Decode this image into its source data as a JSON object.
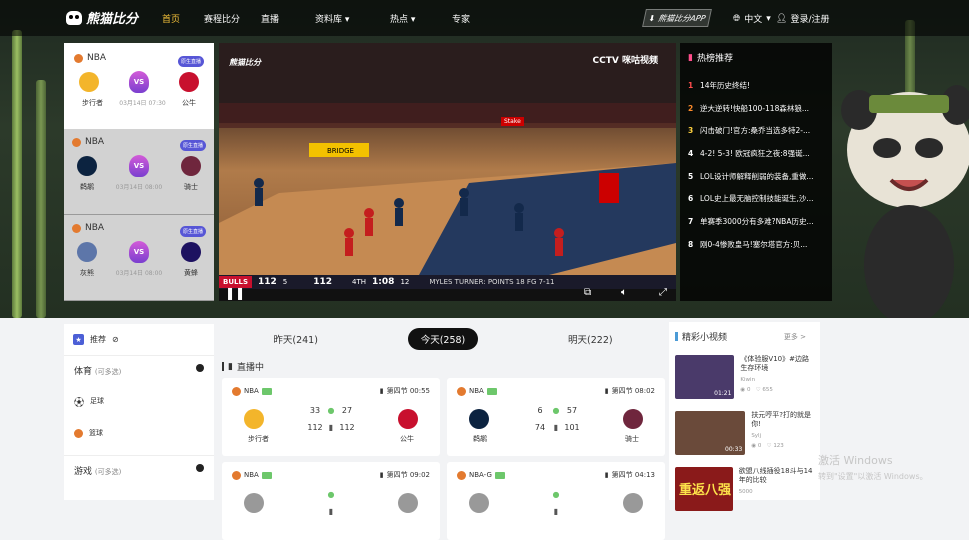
{
  "header": {
    "logo_text": "熊猫比分",
    "nav": [
      "首页",
      "赛程比分",
      "直播",
      "资料库 ▾",
      "热点 ▾",
      "专家"
    ],
    "app_button": "熊猫比分APP",
    "language": "中文",
    "login": "登录/注册"
  },
  "match_list": [
    {
      "league": "NBA",
      "badge": "原生直播",
      "home": "步行者",
      "away": "公牛",
      "time": "03月14日 07:30",
      "home_color": "#f3b52b",
      "away_color": "#c8102e"
    },
    {
      "league": "NBA",
      "badge": "原生直播",
      "home": "鹈鹕",
      "away": "骑士",
      "time": "03月14日 08:00",
      "home_color": "#0c2340",
      "away_color": "#6f263d"
    },
    {
      "league": "NBA",
      "badge": "原生直播",
      "home": "灰熊",
      "away": "黄蜂",
      "time": "03月14日 08:00",
      "home_color": "#5d76a9",
      "away_color": "#1d1160"
    }
  ],
  "vs_label": "VS",
  "player": {
    "logo_text": "熊猫比分",
    "channel": "CCTV 咪咕视频",
    "score_home_abbr": "BULLS",
    "score_home": "112",
    "score_home_fouls": "5",
    "score_away": "112",
    "quarter": "4TH",
    "clock": "1:08",
    "shot_clock": "12",
    "lower_text": "MYLES TURNER: POINTS 18 FG 7-11",
    "court_ad": "Stake"
  },
  "hot": {
    "title": "热榜推荐",
    "items": [
      {
        "num": "1",
        "text": "14年历史终结!",
        "color": "#ff4d4d"
      },
      {
        "num": "2",
        "text": "逆大逆转!快船100-118森林狼...",
        "color": "#ff8c2b"
      },
      {
        "num": "3",
        "text": "闪击破门!官方:桑乔当选多特2-...",
        "color": "#ffd23f"
      },
      {
        "num": "4",
        "text": "4-2! 5-3! 欧冠疯狂之夜:8强诞...",
        "color": "#fff"
      },
      {
        "num": "5",
        "text": "LOL设计师解释削弱的装备,重做...",
        "color": "#fff"
      },
      {
        "num": "6",
        "text": "LOL史上最无脑控制技能诞生,沙...",
        "color": "#fff"
      },
      {
        "num": "7",
        "text": "单赛季3000分有多难?NBA历史...",
        "color": "#fff"
      },
      {
        "num": "8",
        "text": "刚0-4惨败皇马!塞尔塔官方:贝...",
        "color": "#fff"
      }
    ]
  },
  "sidebar": {
    "recommend": "推荐",
    "sports_title": "体育",
    "sports_sub": "(可多选)",
    "football": "足球",
    "basketball": "篮球",
    "games_title": "游戏",
    "games_sub": "(可多选)"
  },
  "date_tabs": [
    "昨天(241)",
    "今天(258)",
    "明天(222)"
  ],
  "live_section_title": "直播中",
  "live_cards": [
    {
      "league": "NBA",
      "period": "第四节 00:55",
      "home": "步行者",
      "away": "公牛",
      "home_q": "33",
      "away_q": "27",
      "home_total": "112",
      "away_total": "112",
      "home_color": "#f3b52b",
      "away_color": "#c8102e"
    },
    {
      "league": "NBA",
      "period": "第四节 08:02",
      "home": "鹈鹕",
      "away": "骑士",
      "home_q": "6",
      "away_q": "57",
      "home_total": "74",
      "away_total": "101",
      "home_color": "#0c2340",
      "away_color": "#6f263d"
    },
    {
      "league": "NBA",
      "period": "第四节 09:02",
      "home": "",
      "away": "",
      "home_q": "",
      "away_q": "",
      "home_total": "",
      "away_total": "",
      "home_color": "#999",
      "away_color": "#999"
    },
    {
      "league": "NBA-G",
      "period": "第四节 04:13",
      "home": "",
      "away": "",
      "home_q": "",
      "away_q": "",
      "home_total": "",
      "away_total": "",
      "home_color": "#999",
      "away_color": "#999"
    }
  ],
  "videos": {
    "title": "精彩小视频",
    "more": "更多 >",
    "items": [
      {
        "title": "《体验服V10》#边路生存环境",
        "author": "Kiwin",
        "views": "0",
        "likes": "655",
        "duration": "01:21",
        "thumb": "#4a3a6a"
      },
      {
        "title": "扶元哼平?打的就是你!",
        "author": "Sylj",
        "views": "0",
        "likes": "123",
        "duration": "00:33",
        "thumb": "#6a4a3a"
      },
      {
        "title": "欲盟八线插役18斗与14年的比较",
        "author": "5000",
        "views": "",
        "likes": "",
        "duration": "",
        "thumb": "#8a1a1a",
        "overlay": "重返八强"
      }
    ]
  },
  "watermark": {
    "line1": "激活 Windows",
    "line2": "转到\"设置\"以激活 Windows。"
  }
}
